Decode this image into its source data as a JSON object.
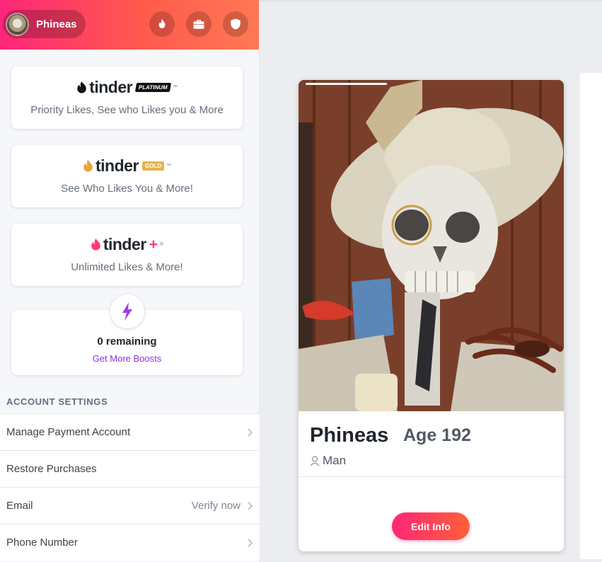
{
  "topbar": {
    "profile_name": "Phineas",
    "icons": [
      "flame-icon",
      "briefcase-icon",
      "shield-icon"
    ]
  },
  "promo_cards": [
    {
      "brand": "tinder",
      "badge": "PLATINUM",
      "tm": "™",
      "subtitle": "Priority Likes, See who Likes you & More",
      "flame_color": "#111111"
    },
    {
      "brand": "tinder",
      "badge": "GOLD",
      "tm": "™",
      "subtitle": "See Who Likes You & More!",
      "flame_color": "#e8a33b"
    },
    {
      "brand": "tinder",
      "badge": "+",
      "tm": "®",
      "subtitle": "Unlimited Likes & More!",
      "flame_color": "#fe3c72"
    }
  ],
  "boost": {
    "count": "0 remaining",
    "link": "Get More Boosts",
    "icon": "lightning-bolt-icon"
  },
  "account_settings": {
    "heading": "ACCOUNT SETTINGS",
    "rows": [
      {
        "label": "Manage Payment Account",
        "value": ""
      },
      {
        "label": "Restore Purchases",
        "value": ""
      },
      {
        "label": "Email",
        "value": "Verify now"
      },
      {
        "label": "Phone Number",
        "value": ""
      }
    ]
  },
  "profile": {
    "name": "Phineas",
    "age": "Age 192",
    "gender": "Man",
    "edit_label": "Edit Info"
  },
  "colors": {
    "brand_gradient_start": "#fd267a",
    "brand_gradient_end": "#ff7854",
    "boost_purple": "#8e2de2"
  }
}
